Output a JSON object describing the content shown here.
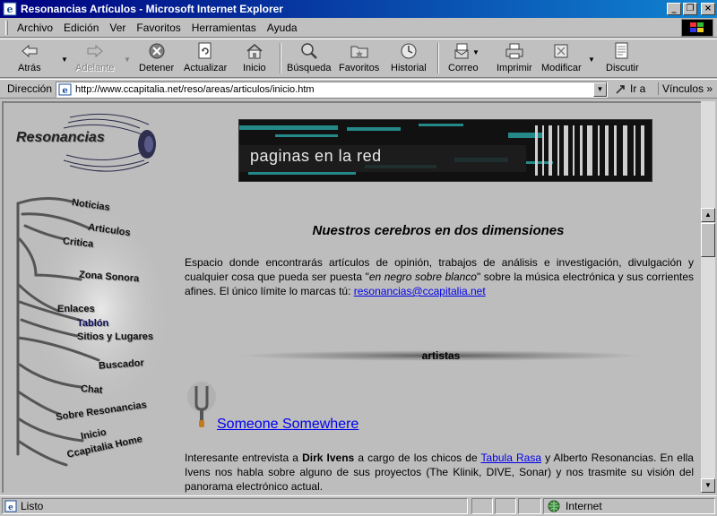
{
  "window": {
    "title": "Resonancias Artículos - Microsoft Internet Explorer",
    "controls": {
      "minimize": "_",
      "maximize": "❐",
      "close": "×"
    }
  },
  "menubar": {
    "items": [
      {
        "label": "Archivo",
        "accel": "A"
      },
      {
        "label": "Edición",
        "accel": "E"
      },
      {
        "label": "Ver",
        "accel": "V"
      },
      {
        "label": "Favoritos",
        "accel": "F"
      },
      {
        "label": "Herramientas",
        "accel": "H"
      },
      {
        "label": "Ayuda",
        "accel": "y"
      }
    ]
  },
  "toolbar": {
    "back": "Atrás",
    "forward": "Adelante",
    "stop": "Detener",
    "refresh": "Actualizar",
    "home": "Inicio",
    "search": "Búsqueda",
    "favorites": "Favoritos",
    "history": "Historial",
    "mail": "Correo",
    "print": "Imprimir",
    "edit": "Modificar",
    "discuss": "Discutir"
  },
  "addressbar": {
    "label": "Dirección",
    "url": "http://www.ccapitalia.net/reso/areas/articulos/inicio.htm",
    "go": "Ir a",
    "links": "Vínculos"
  },
  "page": {
    "logo_text": "Resonancias",
    "nav": [
      "Noticias",
      "Articulos",
      "Critica",
      "Zona Sonora",
      "Enlaces",
      "Tablón",
      "Sitios y Lugares",
      "Buscador",
      "Chat",
      "Sobre Resonancias",
      "Inicio",
      "Ccapitalia Home"
    ],
    "banner_text": "paginas en la red",
    "heading": "Nuestros cerebros en dos dimensiones",
    "intro": {
      "part1": "Espacio donde encontrarás artículos de opinión, trabajos de análisis e investigación, divulgación y cualquier cosa que pueda ser puesta \"",
      "italic": "en negro sobre blanco",
      "part2": "\" sobre la música electrónica y sus corrientes afines.  El único límite lo marcas tú: ",
      "email": "resonancias@ccapitalia.net"
    },
    "section_title": "artistas",
    "article": {
      "title": "Someone Somewhere",
      "body_part1": "Interesante entrevista a ",
      "bold": "Dirk Ivens",
      "body_part2": " a cargo de los chicos de ",
      "link": "Tabula Rasa",
      "body_part3": " y Alberto Resonancias. En ella Ivens nos habla sobre alguno de sus proyectos (The Klinik, DIVE, Sonar) y nos trasmite su visión del panorama electrónico actual."
    }
  },
  "statusbar": {
    "status": "Listo",
    "zone": "Internet"
  }
}
